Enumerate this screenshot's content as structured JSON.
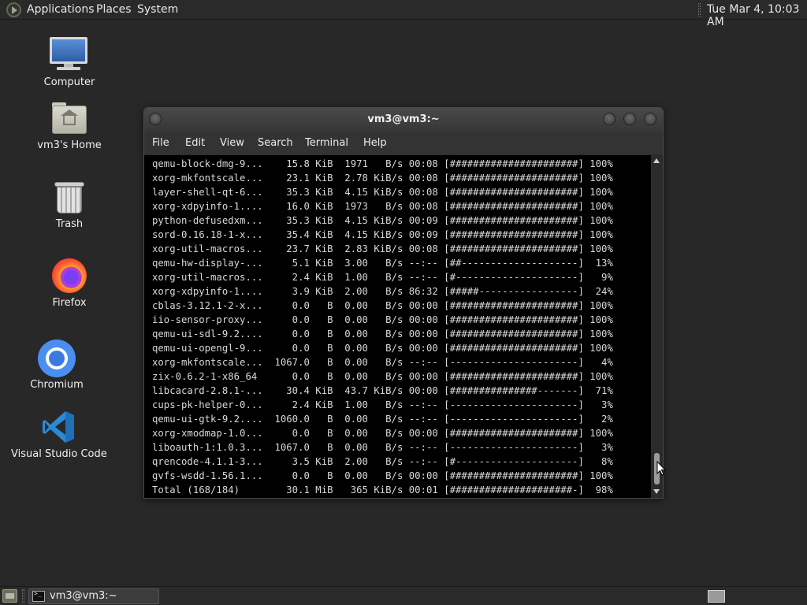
{
  "top_panel": {
    "applications": "Applications",
    "places": "Places",
    "system": "System",
    "clock": "Tue Mar  4, 10:03 AM"
  },
  "desktop_icons": {
    "computer": "Computer",
    "home": "vm3's Home",
    "trash": "Trash",
    "firefox": "Firefox",
    "chromium": "Chromium",
    "vscode": "Visual Studio Code"
  },
  "terminal": {
    "title": "vm3@vm3:~",
    "menu": [
      "File",
      "Edit",
      "View",
      "Search",
      "Terminal",
      "Help"
    ],
    "lines": [
      "qemu-block-dmg-9...    15.8 KiB  1971   B/s 00:08 [######################] 100%",
      "xorg-mkfontscale...    23.1 KiB  2.78 KiB/s 00:08 [######################] 100%",
      "layer-shell-qt-6...    35.3 KiB  4.15 KiB/s 00:08 [######################] 100%",
      "xorg-xdpyinfo-1....    16.0 KiB  1973   B/s 00:08 [######################] 100%",
      "python-defusedxm...    35.3 KiB  4.15 KiB/s 00:09 [######################] 100%",
      "sord-0.16.18-1-x...    35.4 KiB  4.15 KiB/s 00:09 [######################] 100%",
      "xorg-util-macros...    23.7 KiB  2.83 KiB/s 00:08 [######################] 100%",
      "qemu-hw-display-...     5.1 KiB  3.00   B/s --:-- [##--------------------]  13%",
      "xorg-util-macros...     2.4 KiB  1.00   B/s --:-- [#---------------------]   9%",
      "xorg-xdpyinfo-1....     3.9 KiB  2.00   B/s 86:32 [#####-----------------]  24%",
      "cblas-3.12.1-2-x...     0.0   B  0.00   B/s 00:00 [######################] 100%",
      "iio-sensor-proxy...     0.0   B  0.00   B/s 00:00 [######################] 100%",
      "qemu-ui-sdl-9.2....     0.0   B  0.00   B/s 00:00 [######################] 100%",
      "qemu-ui-opengl-9...     0.0   B  0.00   B/s 00:00 [######################] 100%",
      "xorg-mkfontscale...  1067.0   B  0.00   B/s --:-- [----------------------]   4%",
      "zix-0.6.2-1-x86_64      0.0   B  0.00   B/s 00:00 [######################] 100%",
      "libcacard-2.8.1-...    30.4 KiB  43.7 KiB/s 00:00 [###############-------]  71%",
      "cups-pk-helper-0...     2.4 KiB  1.00   B/s --:-- [----------------------]   3%",
      "qemu-ui-gtk-9.2....  1060.0   B  0.00   B/s --:-- [----------------------]   2%",
      "xorg-xmodmap-1.0...     0.0   B  0.00   B/s 00:00 [######################] 100%",
      "liboauth-1:1.0.3...  1067.0   B  0.00   B/s --:-- [----------------------]   3%",
      "qrencode-4.1.1-3...     3.5 KiB  2.00   B/s --:-- [#---------------------]   8%",
      "gvfs-wsdd-1.56.1...     0.0   B  0.00   B/s 00:00 [######################] 100%",
      "Total (168/184)        30.1 MiB   365 KiB/s 00:01 [#####################-]  98%"
    ]
  },
  "taskbar": {
    "task_label": "vm3@vm3:~"
  },
  "colors": {
    "desktop_bg": "#282828",
    "terminal_bg": "#000000",
    "terminal_fg": "#d8d8d8"
  }
}
